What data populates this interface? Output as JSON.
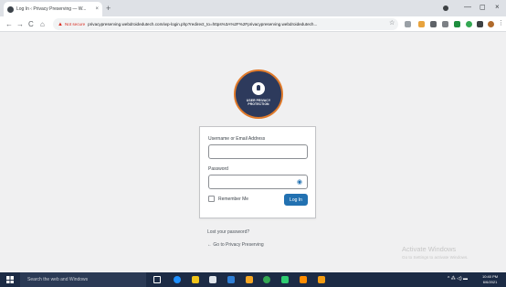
{
  "browser": {
    "tab_title": "Log In ‹ Privacy Preserving — W...",
    "tab_close": "×",
    "new_tab": "+",
    "window_minimize": "—",
    "window_maximize": "◻",
    "window_close": "×",
    "nav_back": "←",
    "nav_forward": "→",
    "nav_reload": "C",
    "nav_home": "⌂",
    "not_secure": "Not secure",
    "url": "privacypreserving.webdroidedutech.com/wp-login.php?redirect_to=https%3A%2F%2Fprivacypreserving.webdroidedutech...",
    "bookmark": "☆",
    "menu": "⋮"
  },
  "logo": {
    "line1": "USER PRIVACY",
    "line2": "PROTECTION"
  },
  "login": {
    "username_label": "Username or Email Address",
    "username_value": "",
    "password_label": "Password",
    "password_value": "",
    "remember_label": "Remember Me",
    "submit_label": "Log In"
  },
  "links": {
    "lost_password": "Lost your password?",
    "back_to_site": "← Go to Privacy Preserving"
  },
  "watermark": {
    "title": "Activate Windows",
    "subtitle": "Go to Settings to activate Windows."
  },
  "taskbar": {
    "search_placeholder": "Search the web and Windows",
    "tray": "^ ⁂ ◁) ▬",
    "time": "10:40 PM",
    "date": "6/6/2021"
  },
  "colors": {
    "primary": "#2271b1",
    "logo_bg": "#2d3a5c",
    "logo_ring": "#e07a2b",
    "warning": "#d93025",
    "taskbar": "#1c2b45"
  }
}
